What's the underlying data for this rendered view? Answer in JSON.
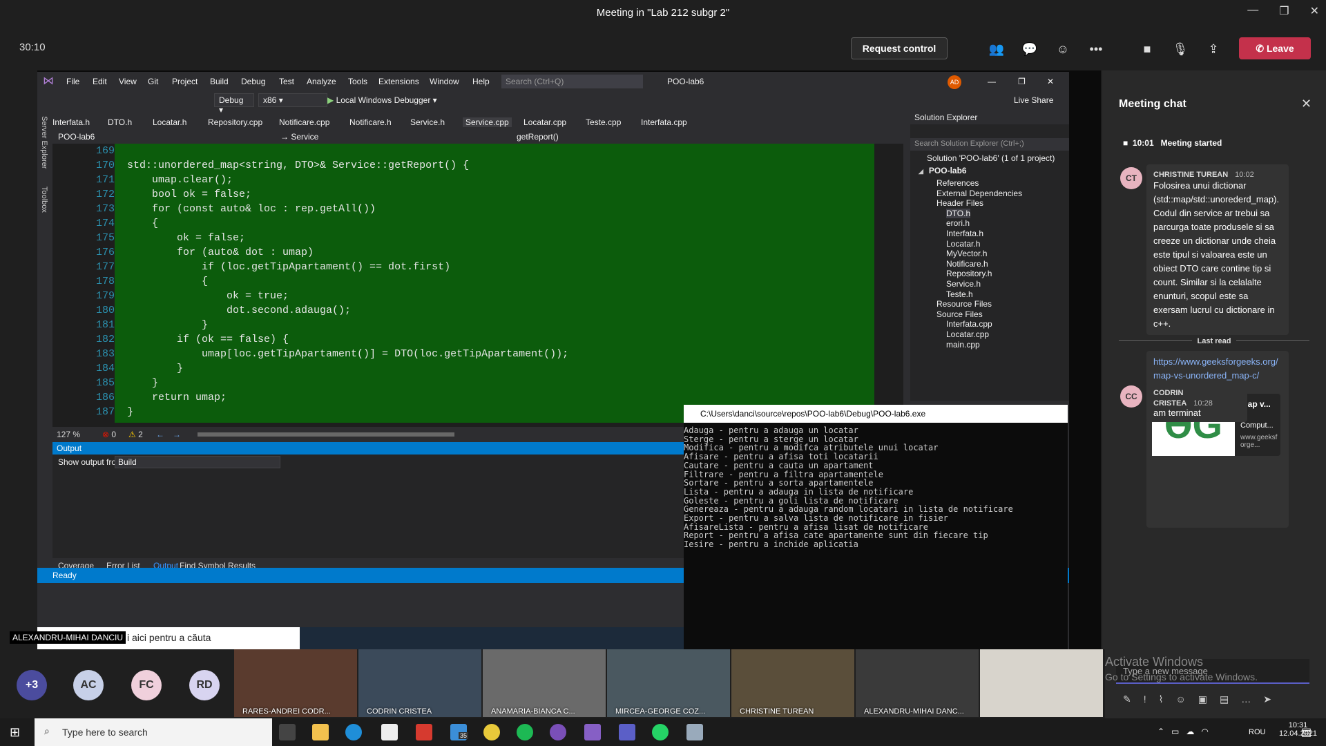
{
  "teams": {
    "window_title": "Meeting in \"Lab 212 subgr 2\"",
    "timer": "30:10",
    "request_control": "Request control",
    "leave": "Leave"
  },
  "vs": {
    "menu": [
      "File",
      "Edit",
      "View",
      "Git",
      "Project",
      "Build",
      "Debug",
      "Test",
      "Analyze",
      "Tools",
      "Extensions",
      "Window",
      "Help"
    ],
    "search_placeholder": "Search (Ctrl+Q)",
    "project": "POO-lab6",
    "avatar": "AD",
    "config": "Debug",
    "platform": "x86",
    "debugger": "Local Windows Debugger",
    "live_share": "Live Share",
    "side_tabs": [
      "Server Explorer",
      "Toolbox"
    ],
    "tabs": [
      "Interfata.h",
      "DTO.h",
      "Locatar.h",
      "Repository.cpp",
      "Notificare.cpp",
      "Notificare.h",
      "Service.h",
      "Service.cpp",
      "Locatar.cpp",
      "Teste.cpp",
      "Interfata.cpp"
    ],
    "nav": {
      "project": "POO-lab6",
      "scope": "Service",
      "member": "getReport()"
    },
    "code_lines": [
      {
        "n": "169",
        "t": ""
      },
      {
        "n": "170",
        "t": "std::unordered_map<string, DTO>& Service::getReport() {"
      },
      {
        "n": "171",
        "t": "    umap.clear();"
      },
      {
        "n": "172",
        "t": "    bool ok = false;"
      },
      {
        "n": "173",
        "t": "    for (const auto& loc : rep.getAll())"
      },
      {
        "n": "174",
        "t": "    {"
      },
      {
        "n": "175",
        "t": "        ok = false;"
      },
      {
        "n": "176",
        "t": "        for (auto& dot : umap)"
      },
      {
        "n": "177",
        "t": "            if (loc.getTipApartament() == dot.first)"
      },
      {
        "n": "178",
        "t": "            {"
      },
      {
        "n": "179",
        "t": "                ok = true;"
      },
      {
        "n": "180",
        "t": "                dot.second.adauga();"
      },
      {
        "n": "181",
        "t": "            }"
      },
      {
        "n": "182",
        "t": "        if (ok == false) {"
      },
      {
        "n": "183",
        "t": "            umap[loc.getTipApartament()] = DTO(loc.getTipApartament());"
      },
      {
        "n": "184",
        "t": "        }"
      },
      {
        "n": "185",
        "t": "    }"
      },
      {
        "n": "186",
        "t": "    return umap;"
      },
      {
        "n": "187",
        "t": "}"
      }
    ],
    "zoom": "127 %",
    "errors": "0",
    "warnings": "2",
    "output_title": "Output",
    "show_output_from": "Show output from:",
    "output_source": "Build",
    "bottom_tabs": [
      "Coverage",
      "Error List",
      "Output",
      "Find Symbol Results"
    ],
    "status": "Ready",
    "solution_explorer": {
      "title": "Solution Explorer",
      "search": "Search Solution Explorer (Ctrl+;)",
      "solution": "Solution 'POO-lab6' (1 of 1 project)",
      "project": "POO-lab6",
      "items": [
        "References",
        "External Dependencies",
        "Header Files",
        "DTO.h",
        "erori.h",
        "Interfata.h",
        "Locatar.h",
        "MyVector.h",
        "Notificare.h",
        "Repository.h",
        "Service.h",
        "Teste.h",
        "Resource Files",
        "Source Files",
        "Interfata.cpp",
        "Locatar.cpp",
        "main.cpp"
      ]
    }
  },
  "console": {
    "title": "C:\\Users\\danci\\source\\repos\\POO-lab6\\Debug\\POO-lab6.exe",
    "lines": [
      "Adauga - pentru a adauga un locatar",
      "Sterge - pentru a sterge un locatar",
      "Modifica - pentru a modifca atributele unui locatar",
      "Afisare - pentru a afisa toti locatarii",
      "Cautare - pentru a cauta un apartament",
      "Filtrare - pentru a filtra apartamentele",
      "Sortare - pentru a sorta apartamentele",
      "Lista - pentru a adauga in lista de notificare",
      "Goleste - pentru a goli lista de notificare",
      "Genereaza - pentru a adauga random locatari in lista de notificare",
      "Export - pentru a salva lista de notificare in fisier",
      "AfisareLista - pentru a afisa lisat de notificare",
      "Report - pentru a afisa cate apartamente sunt din fiecare tip",
      "Iesire - pentru a inchide aplicatia"
    ]
  },
  "remote_taskbar": {
    "search": "i aici pentru a căuta"
  },
  "presenter_name": "ALEXANDRU-MIHAI DANCIU",
  "chat": {
    "title": "Meeting chat",
    "meeting_started_time": "10:01",
    "meeting_started": "Meeting started",
    "msg1": {
      "initials": "CT",
      "author": "CHRISTINE TUREAN",
      "time": "10:02",
      "text": "Folosirea unui dictionar (std::map/std::unorederd_map). Codul din service ar trebui sa parcurga toate produsele si sa creeze un dictionar unde cheia este tipul si valoarea este un obiect DTO care contine tip si count. Similar si la celalalte enunturi, scopul este sa exersam lucrul cu dictionare in c++."
    },
    "last_read": "Last read",
    "link": "https://www.geeksforgeeks.org/map-vs-unordered_map-c/",
    "card": {
      "title": "map v...",
      "desc": "A Comput...",
      "site": "www.geeksforge..."
    },
    "msg2": {
      "initials": "CC",
      "author": "CODRIN CRISTEA",
      "time": "10:28",
      "text": "am terminat"
    },
    "compose_placeholder": "Type a new message",
    "watermark": "Activate Windows",
    "watermark2": "Go to Settings to activate Windows."
  },
  "participants": {
    "more": "+3",
    "avatars": [
      "AC",
      "FC",
      "RD"
    ],
    "tiles": [
      "RARES-ANDREI CODR...",
      "CODRIN CRISTEA",
      "ANAMARIA-BIANCA C...",
      "MIRCEA-GEORGE COZ...",
      "CHRISTINE TUREAN",
      "ALEXANDRU-MIHAI DANC..."
    ]
  },
  "taskbar": {
    "search": "Type here to search",
    "mail_badge": "35",
    "lang": "ROU",
    "time": "10:31",
    "date": "12.04.2021"
  }
}
